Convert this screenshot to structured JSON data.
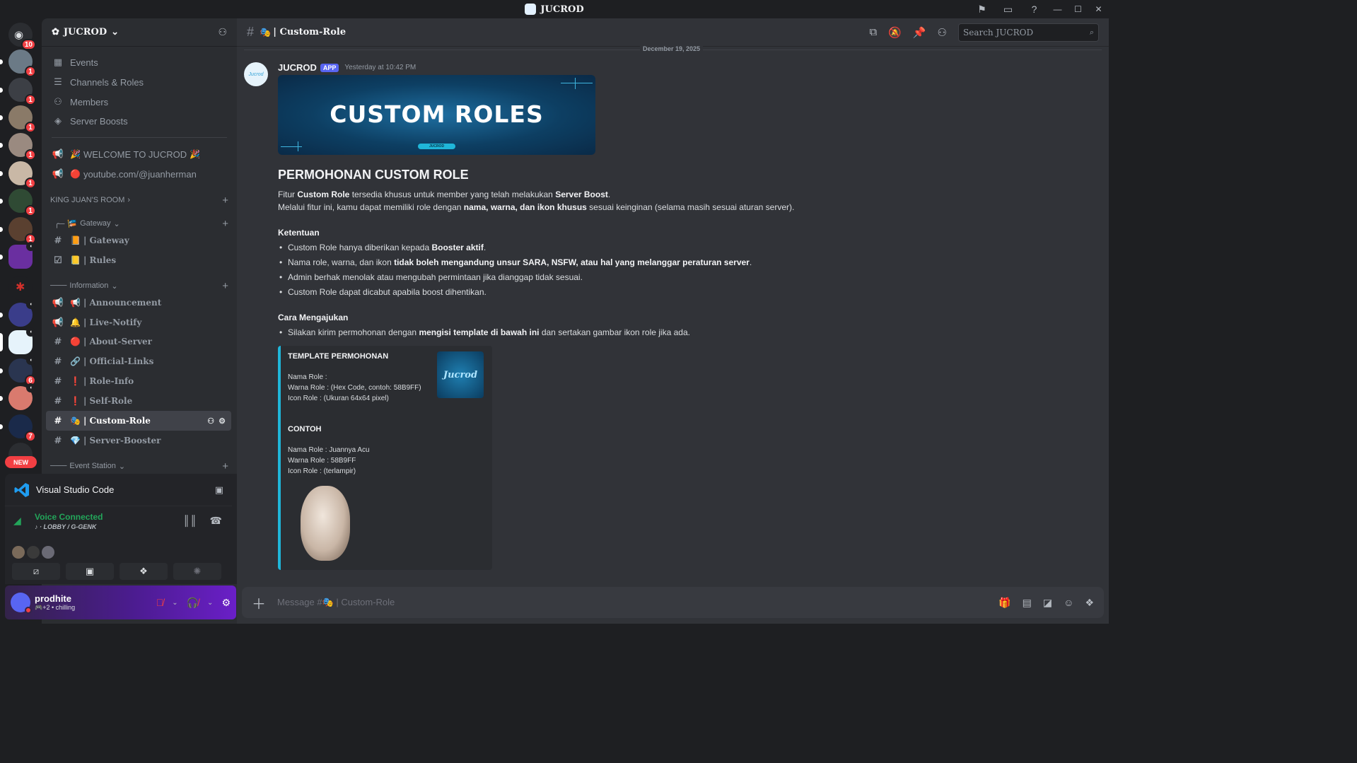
{
  "window": {
    "title": "JUCROD"
  },
  "server": {
    "name": "JUCROD",
    "dm_badge": "10",
    "guild_badges": [
      "1",
      "1",
      "1",
      "1",
      "1",
      "1",
      "1",
      "1"
    ],
    "guild_badges_lower": [
      "6",
      "7"
    ],
    "new_label": "NEW"
  },
  "sidebar": {
    "top_items": [
      {
        "label": "Events"
      },
      {
        "label": "Channels & Roles"
      },
      {
        "label": "Members"
      },
      {
        "label": "Server Boosts"
      }
    ],
    "announcements": [
      {
        "emoji": "🎉",
        "label": "WELCOME TO JUCROD",
        "emoji2": "🎉"
      },
      {
        "emoji": "🔴",
        "label": "youtube.com/@juanherman"
      }
    ],
    "category_room": "KING JUAN'S ROOM",
    "cat_gateway": "Gateway",
    "gateway_channels": [
      {
        "emoji": "📙",
        "label": "Gateway"
      },
      {
        "emoji": "📒",
        "label": "Rules"
      }
    ],
    "cat_information": "Information",
    "info_channels": [
      {
        "emoji": "📢",
        "label": "Announcement"
      },
      {
        "emoji": "🔔",
        "label": "Live-Notify"
      },
      {
        "emoji": "🔴",
        "label": "About-Server"
      },
      {
        "emoji": "🔗",
        "label": "Official-Links"
      },
      {
        "emoji": "❗",
        "label": "Role-Info"
      },
      {
        "emoji": "❗",
        "label": "Self-Role"
      },
      {
        "emoji": "🎭",
        "label": "Custom-Role"
      },
      {
        "emoji": "💎",
        "label": "Server-Booster"
      }
    ],
    "cat_event": "Event Station"
  },
  "activity": {
    "app": "Visual Studio Code",
    "voice_status": "Voice Connected",
    "voice_location": "LOBBY / G-GENK"
  },
  "user": {
    "name": "prodhite",
    "status_extra": "+2",
    "status_text": "chilling"
  },
  "channel": {
    "name": "Custom-Role",
    "emoji": "🎭",
    "search_placeholder": "Search JUCROD"
  },
  "message": {
    "date_divider": "December 19, 2025",
    "author": "JUCROD",
    "app_tag": "APP",
    "timestamp": "Yesterday at 10:42 PM",
    "avatar_text": "Jucrod",
    "banner_title": "CUSTOM ROLES",
    "banner_sub": "JUCROD",
    "heading": "PERMOHONAN CUSTOM ROLE",
    "p1_a": "Fitur ",
    "p1_b": "Custom Role",
    "p1_c": " tersedia khusus untuk member yang telah melakukan ",
    "p1_d": "Server Boost",
    "p1_e": ".",
    "p2_a": "Melalui fitur ini, kamu dapat memiliki role dengan ",
    "p2_b": "nama, warna, dan ikon khusus",
    "p2_c": " sesuai keinginan (selama masih sesuai aturan server).",
    "ketentuan_title": "Ketentuan",
    "k1_a": "Custom Role hanya diberikan kepada ",
    "k1_b": "Booster aktif",
    "k1_c": ".",
    "k2_a": "Nama role, warna, dan ikon ",
    "k2_b": "tidak boleh mengandung unsur SARA, NSFW, atau hal yang melanggar peraturan server",
    "k2_c": ".",
    "k3": "Admin berhak menolak atau mengubah permintaan jika dianggap tidak sesuai.",
    "k4": "Custom Role dapat dicabut apabila boost dihentikan.",
    "cara_title": "Cara Mengajukan",
    "c1_a": "Silakan kirim permohonan dengan ",
    "c1_b": "mengisi template di bawah ini",
    "c1_c": " dan sertakan gambar ikon role jika ada."
  },
  "embed": {
    "title": "TEMPLATE PERMOHONAN",
    "thumb_text": "Jucrod",
    "l1": "Nama Role :",
    "l2": "Warna Role : (Hex Code, contoh: 58B9FF)",
    "l3": "Icon Role : (Ukuran 64x64 pixel)",
    "contoh": "CONTOH",
    "c1": "Nama Role : Juannya Acu",
    "c2": "Warna Role : 58B9FF",
    "c3": "Icon Role : (terlampir)"
  },
  "composer": {
    "placeholder": "Message #🎭 | Custom-Role"
  }
}
